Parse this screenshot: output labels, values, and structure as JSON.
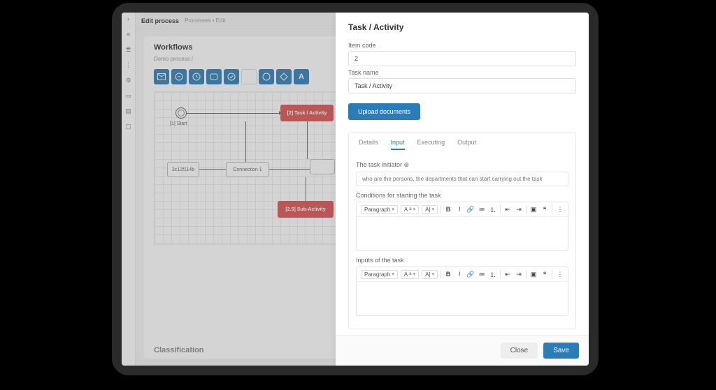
{
  "header": {
    "edit_label": "Edit process",
    "crumb": "Processes • Edit"
  },
  "workflow_card": {
    "title": "Workflows",
    "breadcrumb": "Demo process /",
    "classification_label": "Classification"
  },
  "canvas": {
    "start_label": "[1] Start",
    "task_label": "[2] Task / Activity",
    "box1_label": "3c12f114b",
    "conn_label": "Connection 1",
    "sub_label": "[2.5] Sub-Activity"
  },
  "tool_icons": [
    "mail",
    "clock-stop",
    "clock",
    "rect",
    "check-circle",
    "circle-fill",
    "circle-outline",
    "diamond",
    "text-a"
  ],
  "panel": {
    "title": "Task / Activity",
    "item_code_label": "Item code",
    "item_code_value": "2",
    "task_name_label": "Task name",
    "task_name_value": "Task / Activity",
    "upload_label": "Upload documents",
    "tabs": [
      "Details",
      "Input",
      "Executing",
      "Output"
    ],
    "active_tab": 1,
    "initiator_label": "The task initiator ⊛",
    "initiator_placeholder": "who are the persons, the departments that can start carrying out the task",
    "conditions_label": "Conditions for starting the task",
    "inputs_label": "Inputs of the task",
    "paragraph_label": "Paragraph",
    "close_label": "Close",
    "save_label": "Save"
  }
}
